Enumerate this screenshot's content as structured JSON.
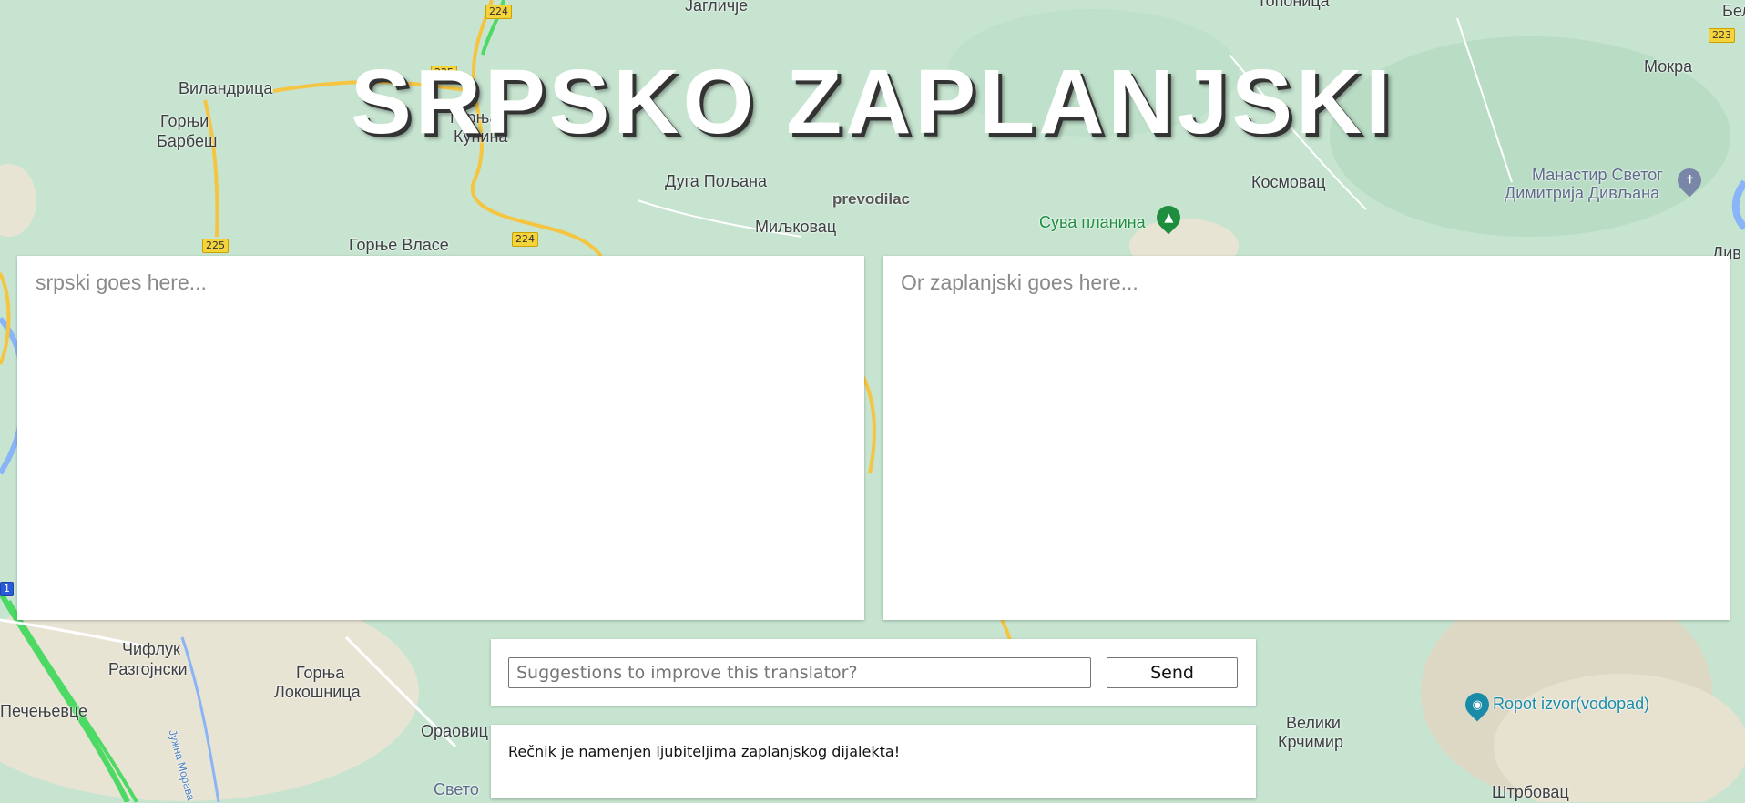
{
  "title": "SRPSKO ZAPLANJSKI",
  "map": {
    "labels": {
      "jaglicje": "Јагличје",
      "toponica": "Топоница",
      "vilandrica": "Виландрица",
      "gornji_barbes_1": "Горњи",
      "gornji_barbes_2": "Барбеш",
      "gornja_kunina_1": "Горња",
      "gornja_kunina_2": "Кунина",
      "dugo_poljana": "Дуга Пољана",
      "miljkovac": "Миљковац",
      "gornje_vlase": "Горње Власе",
      "kosmovac": "Космовац",
      "mokra": "Мокра",
      "sveti_dimitrije_1": "Манастир Светог",
      "sveti_dimitrije_2": "Димитрија Дивљана",
      "suva_planina": "Сува планина",
      "prevodilac": "prevodilac",
      "ciflik_1": "Чифлук",
      "ciflik_2": "Разгојнски",
      "pecenjevce": "Печењевце",
      "gornja_lokosnica_1": "Горња",
      "gornja_lokosnica_2": "Локошница",
      "oraovica": "Ораовиц",
      "sveto": "Свето",
      "veliki_krcimir_1": "Велики",
      "veliki_krcimir_2": "Крчимир",
      "ropot": "Ropot izvor(vodopad)",
      "strbovac": "Штрбовац",
      "juzna_morava": "Јужна Морава",
      "beli": "Бел",
      "div": "Див"
    },
    "shields": [
      "224",
      "225",
      "225",
      "224",
      "223",
      "1"
    ],
    "colors": {
      "green": "#c6e4d0",
      "road": "#f5c542",
      "highway": "#4cd964",
      "river": "#8ab4f8"
    }
  },
  "translator": {
    "left_placeholder": "srpski goes here...",
    "right_placeholder": "Or zaplanjski goes here..."
  },
  "suggestions": {
    "placeholder": "Suggestions to improve this translator?",
    "send_label": "Send"
  },
  "info": {
    "text": "Rečnik je namenjen ljubiteljima zaplanjskog dijalekta!"
  }
}
